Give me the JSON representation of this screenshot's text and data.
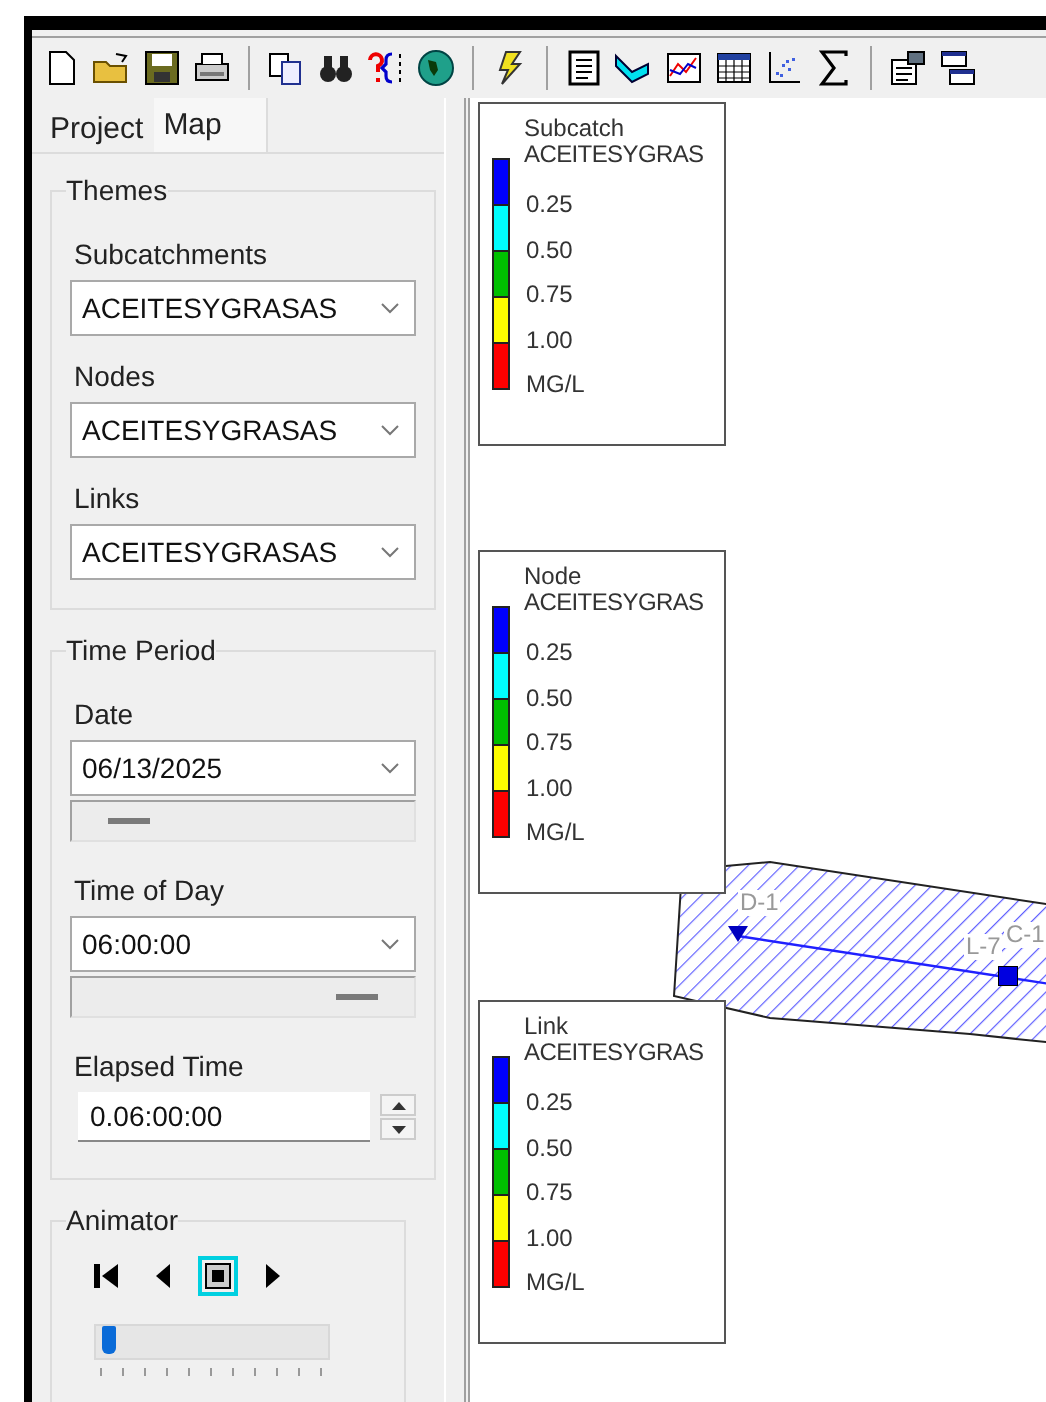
{
  "toolbar": [
    {
      "kind": "new"
    },
    {
      "kind": "open"
    },
    {
      "kind": "save"
    },
    {
      "kind": "print"
    },
    {
      "kind": "sep"
    },
    {
      "kind": "copy"
    },
    {
      "kind": "find"
    },
    {
      "kind": "query"
    },
    {
      "kind": "globe"
    },
    {
      "kind": "sep"
    },
    {
      "kind": "run"
    },
    {
      "kind": "sep"
    },
    {
      "kind": "report"
    },
    {
      "kind": "profile"
    },
    {
      "kind": "timeseries"
    },
    {
      "kind": "table"
    },
    {
      "kind": "scatter"
    },
    {
      "kind": "sigma"
    },
    {
      "kind": "sep"
    },
    {
      "kind": "properties"
    },
    {
      "kind": "windows"
    }
  ],
  "tabs": [
    {
      "label": "Project",
      "selected": false
    },
    {
      "label": "Map",
      "selected": true
    }
  ],
  "themes": {
    "title": "Themes",
    "fields": [
      {
        "label": "Subcatchments",
        "value": "ACEITESYGRASAS"
      },
      {
        "label": "Nodes",
        "value": "ACEITESYGRASAS"
      },
      {
        "label": "Links",
        "value": "ACEITESYGRASAS"
      }
    ]
  },
  "time_period": {
    "title": "Time Period",
    "date": {
      "label": "Date",
      "value": "06/13/2025",
      "level": 0.12
    },
    "time_of_day": {
      "label": "Time of Day",
      "value": "06:00:00",
      "level": 0.88
    },
    "elapsed": {
      "label": "Elapsed Time",
      "value": "0.06:00:00"
    }
  },
  "animator": {
    "title": "Animator",
    "buttons": [
      {
        "kind": "rewind",
        "selected": false
      },
      {
        "kind": "back",
        "selected": false
      },
      {
        "kind": "stop",
        "selected": true
      },
      {
        "kind": "forward",
        "selected": false
      }
    ],
    "level": 0.03
  },
  "legends": [
    {
      "title": "Subcatch",
      "variable": "ACEITESYGRAS",
      "breaks": [
        "0.25",
        "0.50",
        "0.75",
        "1.00"
      ],
      "units": "MG/L",
      "bands": [
        {
          "color": "#0000ff"
        },
        {
          "color": "#00ffff"
        },
        {
          "color": "#00c000"
        },
        {
          "color": "#ffff00"
        },
        {
          "color": "#ff0000"
        }
      ]
    },
    {
      "title": "Node",
      "variable": "ACEITESYGRAS",
      "breaks": [
        "0.25",
        "0.50",
        "0.75",
        "1.00"
      ],
      "units": "MG/L",
      "bands": [
        {
          "color": "#0000ff"
        },
        {
          "color": "#00ffff"
        },
        {
          "color": "#00c000"
        },
        {
          "color": "#ffff00"
        },
        {
          "color": "#ff0000"
        }
      ]
    },
    {
      "title": "Link",
      "variable": "ACEITESYGRAS",
      "breaks": [
        "0.25",
        "0.50",
        "0.75",
        "1.00"
      ],
      "units": "MG/L",
      "bands": [
        {
          "color": "#0000ff"
        },
        {
          "color": "#00ffff"
        },
        {
          "color": "#00c000"
        },
        {
          "color": "#ffff00"
        },
        {
          "color": "#ff0000"
        }
      ]
    }
  ],
  "map": {
    "labels": [
      {
        "text": "D-1"
      },
      {
        "text": "L-7"
      },
      {
        "text": "C-1"
      }
    ]
  }
}
